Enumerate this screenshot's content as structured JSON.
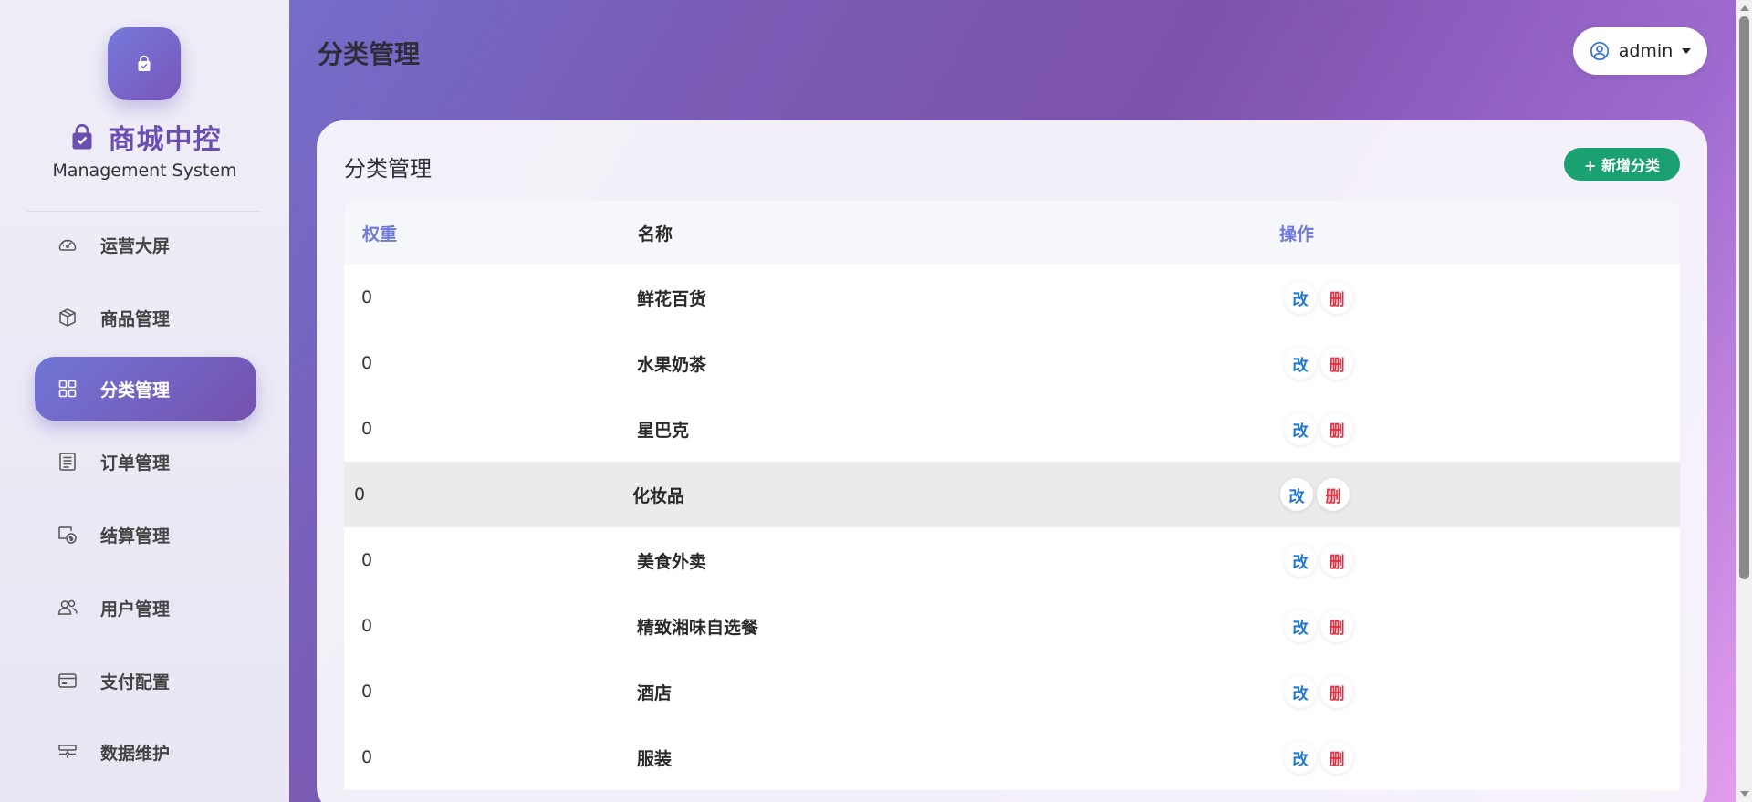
{
  "colors": {
    "accent": "#6f79d8",
    "active_nav": "#7651ae",
    "add_button": "#1aa071",
    "edit": "#1c74d4",
    "delete": "#dc3545"
  },
  "sidebar": {
    "brand_title": "商城中控",
    "brand_subtitle": "Management System",
    "items": [
      {
        "label": "运营大屏",
        "icon": "dashboard-icon",
        "active": false
      },
      {
        "label": "商品管理",
        "icon": "box-icon",
        "active": false
      },
      {
        "label": "分类管理",
        "icon": "grid-icon",
        "active": true
      },
      {
        "label": "订单管理",
        "icon": "list-icon",
        "active": false
      },
      {
        "label": "结算管理",
        "icon": "settlement-icon",
        "active": false
      },
      {
        "label": "用户管理",
        "icon": "users-icon",
        "active": false
      },
      {
        "label": "支付配置",
        "icon": "card-icon",
        "active": false
      },
      {
        "label": "数据维护",
        "icon": "data-icon",
        "active": false
      }
    ]
  },
  "header": {
    "title": "分类管理",
    "user_name": "admin"
  },
  "main": {
    "card_title": "分类管理",
    "add_label": "+ 新增分类",
    "columns": [
      "权重",
      "名称",
      "操作"
    ],
    "rows": [
      {
        "weight": "0",
        "name": "鲜花百货"
      },
      {
        "weight": "0",
        "name": "水果奶茶"
      },
      {
        "weight": "0",
        "name": "星巴克"
      },
      {
        "weight": "0",
        "name": "化妆品"
      },
      {
        "weight": "0",
        "name": "美食外卖"
      },
      {
        "weight": "0",
        "name": "精致湘味自选餐"
      },
      {
        "weight": "0",
        "name": "酒店"
      },
      {
        "weight": "0",
        "name": "服装"
      }
    ],
    "edit_label": "改",
    "delete_label": "删"
  }
}
